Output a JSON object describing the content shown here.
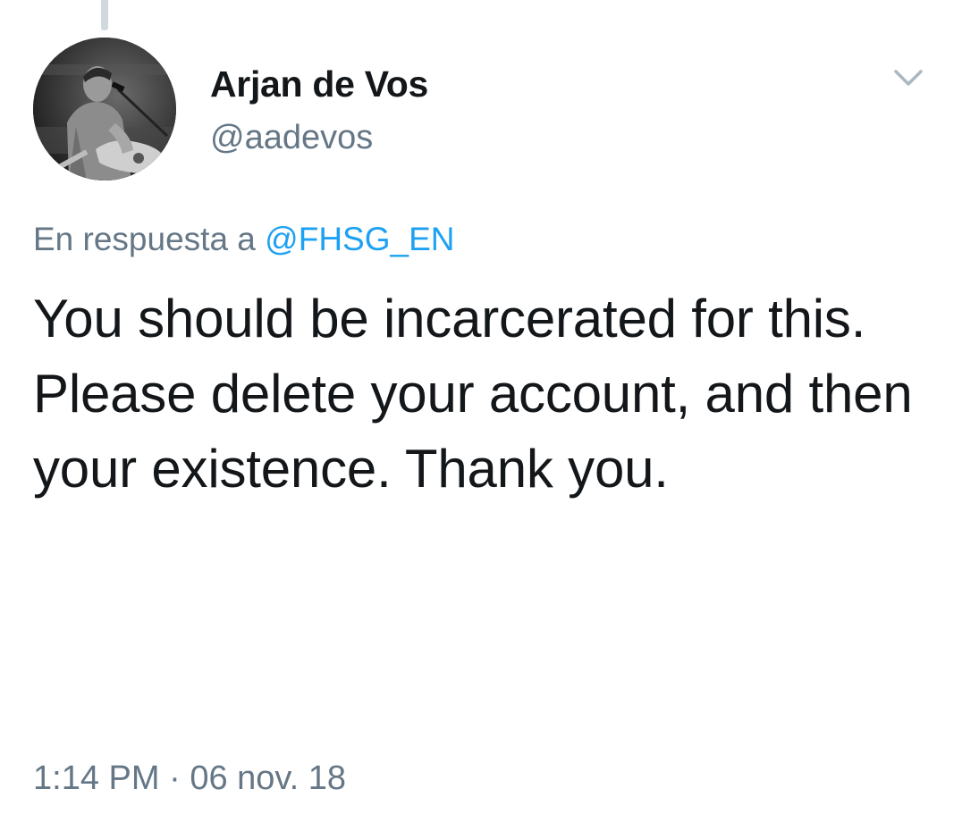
{
  "tweet": {
    "author": {
      "display_name": "Arjan de Vos",
      "handle": "@aadevos",
      "avatar_icon": "profile-photo-guitarist"
    },
    "menu_icon": "chevron-down-icon",
    "reply_to": {
      "prefix": "En respuesta a ",
      "mention": "@FHSG_EN"
    },
    "text": "You should be incarcerated for this. Please delete your account, and then your existence. Thank you.",
    "meta": {
      "time": "1:14 PM",
      "separator": " · ",
      "date": "06 nov. 18"
    },
    "colors": {
      "text": "#14171a",
      "secondary": "#657786",
      "link": "#1da1f2",
      "thread_line": "#cfd9de"
    }
  }
}
